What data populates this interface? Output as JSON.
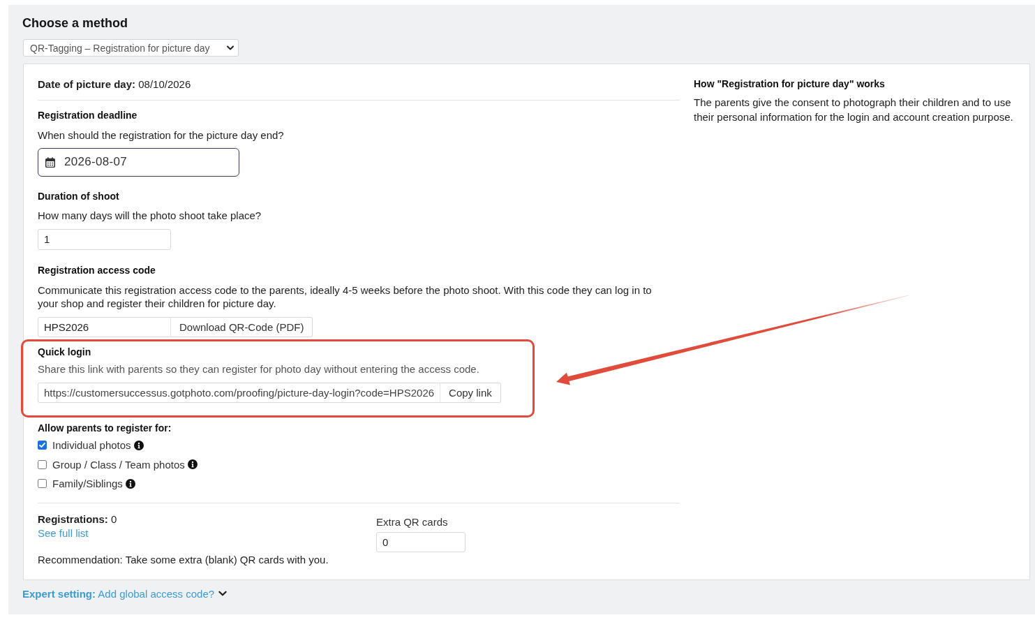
{
  "heading": "Choose a method",
  "method_select": {
    "value": "QR-Tagging – Registration for picture day"
  },
  "settings": {
    "date_of_picture_day": "**Date of picture day:** 08/10/2026",
    "registration_deadline": {
      "heading": "Registration deadline",
      "question": "When should the registration for the picture day end?",
      "value": "2026-08-07"
    },
    "duration_of_shoot": {
      "heading": "Duration of shoot",
      "question": "How many days will the photo shoot take place?",
      "value": "1"
    },
    "access_code": {
      "heading": "Registration access code",
      "description": "Communicate this registration access code to the parents, ideally 4-5 weeks before the photo shoot. With this code they can log in to your shop and register their children for picture day.",
      "value": "HPS2026",
      "button": "Download QR-Code (PDF)"
    },
    "quick_login": {
      "highlighted": true,
      "heading": "Quick login",
      "description": "Share this link with parents so they can register for photo day without entering the access code.",
      "value": "https://customersuccessus.gotphoto.com/proofing/picture-day-login?code=HPS2026",
      "button": "Copy link"
    },
    "register_for": {
      "heading": "Allow parents to register for:",
      "options": [
        {
          "label": "Individual photos",
          "checked": true
        },
        {
          "label": "Group / Class / Team photos",
          "checked": false
        },
        {
          "label": "Family/Siblings",
          "checked": false
        }
      ]
    },
    "registrations": {
      "summary": "**Registrations:** 0",
      "link": "See full list",
      "recommendation": "Recommendation: Take some extra (blank) QR cards with you."
    },
    "extra_qr_cards": {
      "label": "Extra QR cards",
      "value": "0"
    }
  },
  "info": {
    "heading": "How \"Registration for picture day\" works",
    "text": "The parents give the consent to photograph their children and to use their personal information for the login and account creation purpose."
  },
  "expert_setting": {
    "text": "**Expert setting:** Add global access code?",
    "expanded": false
  }
}
